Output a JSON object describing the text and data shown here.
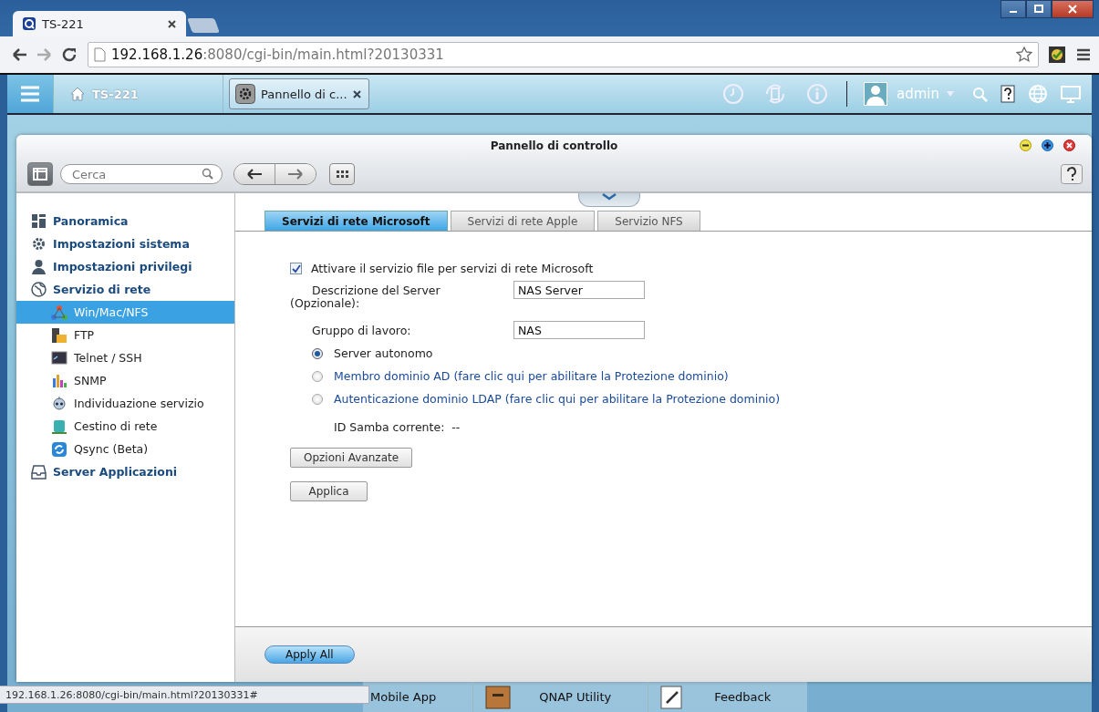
{
  "browser": {
    "tabs": [
      {
        "title": "TS-221",
        "selected": true
      }
    ],
    "address": {
      "host": "192.168.1.26",
      "rest": ":8080/cgi-bin/main.html?20130331"
    }
  },
  "topbar": {
    "device": "TS-221",
    "app_tabs": [
      {
        "label": "Pannello di c...",
        "selected": true
      }
    ],
    "user": "admin"
  },
  "window": {
    "title": "Pannello di controllo",
    "search": {
      "placeholder": "Cerca"
    }
  },
  "sidebar": {
    "items": [
      {
        "label": "Panoramica",
        "selected": false
      },
      {
        "label": "Impostazioni sistema",
        "selected": false
      },
      {
        "label": "Impostazioni privilegi",
        "selected": false
      },
      {
        "label": "Servizio di rete",
        "selected": false,
        "children": [
          {
            "label": "Win/Mac/NFS",
            "selected": true
          },
          {
            "label": "FTP",
            "selected": false
          },
          {
            "label": "Telnet / SSH",
            "selected": false
          },
          {
            "label": "SNMP",
            "selected": false
          },
          {
            "label": "Individuazione servizio",
            "selected": false
          },
          {
            "label": "Cestino di rete",
            "selected": false
          },
          {
            "label": "Qsync (Beta)",
            "selected": false
          }
        ]
      },
      {
        "label": "Server Applicazioni",
        "selected": false
      }
    ]
  },
  "tabs": [
    {
      "label": "Servizi di rete Microsoft",
      "selected": true
    },
    {
      "label": "Servizi di rete Apple",
      "selected": false
    },
    {
      "label": "Servizio NFS",
      "selected": false
    }
  ],
  "form": {
    "enable": {
      "label": "Attivare il servizio file per servizi di rete Microsoft",
      "checked": true
    },
    "fields": [
      {
        "label": "Descrizione del Server (Opzionale):",
        "value": "NAS Server"
      },
      {
        "label": "Gruppo di lavoro:",
        "value": "NAS"
      }
    ],
    "modes": [
      {
        "label": "Server autonomo",
        "selected": true
      },
      {
        "label": "Membro dominio AD (fare clic qui per abilitare la Protezione dominio)",
        "selected": false
      },
      {
        "label": "Autenticazione dominio LDAP (fare clic qui per abilitare la Protezione dominio)",
        "selected": false
      }
    ],
    "samba_id": {
      "label": "ID Samba corrente:",
      "value": "--"
    },
    "buttons": [
      "Opzioni Avanzate",
      "Applica"
    ]
  },
  "footer": {
    "button": "Apply All"
  },
  "dock": {
    "items": [
      "Mobile App",
      "QNAP Utility",
      "Feedback"
    ]
  },
  "status_url": "192.168.1.26:8080/cgi-bin/main.html?20130331#"
}
